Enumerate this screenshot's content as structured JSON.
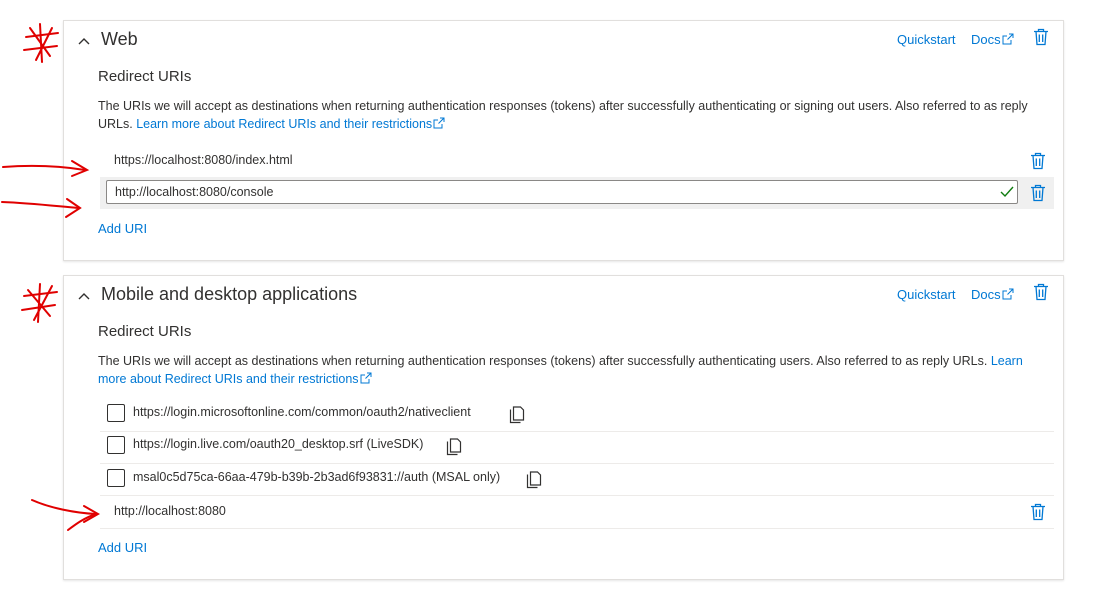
{
  "web": {
    "title": "Web",
    "quickstart": "Quickstart",
    "docs": "Docs",
    "section_title": "Redirect URIs",
    "description": "The URIs we will accept as destinations when returning authentication responses (tokens) after successfully authenticating or signing out users. Also referred to as reply URLs. ",
    "learn_more": "Learn more about Redirect URIs and their restrictions",
    "uris": [
      "https://localhost:8080/index.html"
    ],
    "editing_uri": "http://localhost:8080/console",
    "add_uri": "Add URI"
  },
  "mobile": {
    "title": "Mobile and desktop applications",
    "quickstart": "Quickstart",
    "docs": "Docs",
    "section_title": "Redirect URIs",
    "description": "The URIs we will accept as destinations when returning authentication responses (tokens) after successfully authenticating users. Also referred to as reply URLs. ",
    "learn_more": "Learn more about Redirect URIs and their restrictions",
    "suggested": [
      {
        "uri": "https://login.microsoftonline.com/common/oauth2/nativeclient",
        "checked": false
      },
      {
        "uri": "https://login.live.com/oauth20_desktop.srf (LiveSDK)",
        "checked": false
      },
      {
        "uri": "msal0c5d75ca-66aa-479b-b39b-2b3ad6f93831://auth (MSAL only)",
        "checked": false
      }
    ],
    "custom_uris": [
      "http://localhost:8080"
    ],
    "add_uri": "Add URI"
  },
  "colors": {
    "link": "#0078d4",
    "text": "#323130",
    "border": "#e1dfdd",
    "annotation": "#e00000",
    "valid_check": "#107c10"
  },
  "icons": [
    "chevron-up-icon",
    "external-link-icon",
    "trash-icon",
    "checkmark-icon",
    "copy-icon"
  ]
}
